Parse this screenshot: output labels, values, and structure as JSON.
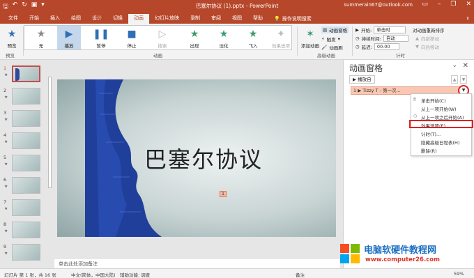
{
  "titlebar": {
    "doc_title": "巴塞尔协议 (1).pptx - PowerPoint",
    "account": "summerain67@outlook.com",
    "qat": [
      "save-icon",
      "undo-icon",
      "redo-icon",
      "present-icon",
      "customize-icon"
    ]
  },
  "tabs": [
    "文件",
    "开始",
    "插入",
    "绘图",
    "设计",
    "切换",
    "动画",
    "幻灯片放映",
    "录制",
    "审阅",
    "视图",
    "帮助"
  ],
  "active_tab": "动画",
  "search_label": "操作说明搜索",
  "ribbon": {
    "preview": "预览",
    "preview_group": "预览",
    "anims": [
      "无",
      "播放",
      "暂停",
      "停止",
      "搜索",
      "出现",
      "淡化",
      "飞入"
    ],
    "effect_options": "效果选项",
    "animation_group": "动画",
    "add_animation": "添加动画",
    "anim_pane_btn": "动画窗格",
    "trigger": "触发",
    "anim_painter": "动画刷",
    "advanced_group": "高级动画",
    "start_label": "开始:",
    "start_value": "单击时",
    "duration_label": "持续时间:",
    "duration_value": "自动",
    "delay_label": "延迟:",
    "delay_value": "00.00",
    "reorder": "对动画重新排序",
    "move_earlier": "向前移动",
    "move_later": "向后移动",
    "timing_group": "计时"
  },
  "thumbnails": {
    "numbers": [
      "1",
      "2",
      "3",
      "4",
      "5",
      "6",
      "7",
      "8",
      "9"
    ]
  },
  "slide": {
    "title": "巴塞尔协议",
    "tag": "1"
  },
  "notes_placeholder": "单击此处添加备注",
  "pane": {
    "title": "动画窗格",
    "play_from": "播放自",
    "item_text": "1 ▶ Tizzy T - 第一次..."
  },
  "menu": {
    "items": [
      "单击开始(C)",
      "从上一项开始(W)",
      "从上一项之后开始(A)",
      "效果选项(E)...",
      "计时(T)...",
      "隐藏高级日程表(H)",
      "删除(R)"
    ],
    "highlighted": "效果选项(E)..."
  },
  "status": {
    "slide_info": "幻灯片 第 1 张，共 16 张",
    "language": "中文(简体，中国大陆)",
    "accessibility": "辅助功能: 调查",
    "notes": "备注",
    "zoom": "59%"
  },
  "watermark": {
    "title": "电脑软硬件教程网",
    "url": "www.computer26.com"
  },
  "colors": {
    "accent": "#b7472a",
    "highlight_red": "#e02020",
    "logo_blue": "#1a6fc2"
  }
}
